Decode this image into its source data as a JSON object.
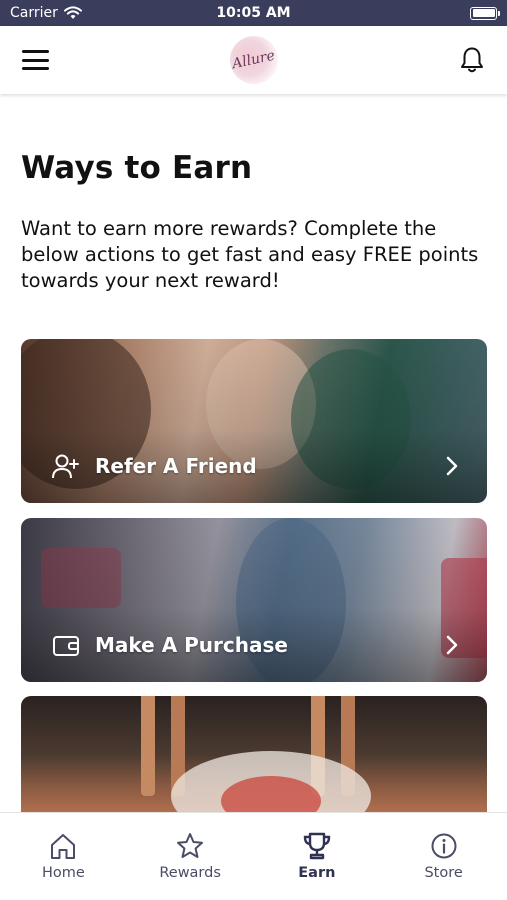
{
  "status_bar": {
    "carrier": "Carrier",
    "time": "10:05 AM",
    "battery_level": 1.0
  },
  "header": {
    "menu_icon": "hamburger-menu-icon",
    "logo_text": "Allure",
    "notification_icon": "bell-icon"
  },
  "main": {
    "title": "Ways to Earn",
    "description": "Want to earn more rewards? Complete the below actions to get fast and easy FREE points towards your next reward!",
    "cards": [
      {
        "label": "Refer A Friend",
        "icon": "add-user-icon",
        "action_icon": "chevron-right-icon"
      },
      {
        "label": "Make A Purchase",
        "icon": "wallet-icon",
        "action_icon": "chevron-right-icon"
      },
      {
        "label": "",
        "icon": "",
        "action_icon": ""
      }
    ]
  },
  "tab_bar": {
    "active": "Earn",
    "tabs": [
      {
        "label": "Home",
        "icon": "home-icon"
      },
      {
        "label": "Rewards",
        "icon": "star-icon"
      },
      {
        "label": "Earn",
        "icon": "trophy-icon"
      },
      {
        "label": "Store",
        "icon": "info-icon"
      }
    ]
  },
  "colors": {
    "status_bar_bg": "#3a3d5c",
    "tab_inactive": "#4a4d66",
    "tab_active": "#2f3252",
    "text_primary": "#111111"
  }
}
